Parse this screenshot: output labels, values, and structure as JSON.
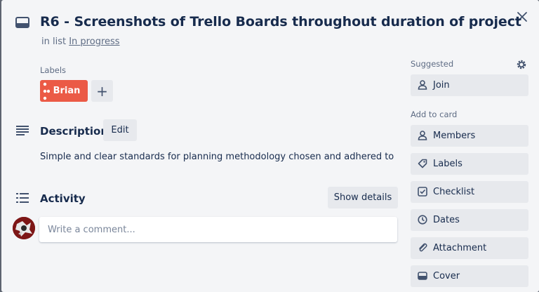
{
  "card": {
    "title": "R6 - Screenshots of Trello Boards throughout duration of project",
    "in_list_prefix": "in list",
    "list_name": "In progress"
  },
  "labels": {
    "heading": "Labels",
    "items": [
      {
        "name": "Brian",
        "color": "#eb5a46"
      }
    ],
    "add_symbol": "+"
  },
  "description": {
    "heading": "Description",
    "edit_label": "Edit",
    "text": "Simple and clear standards for planning methodology chosen and adhered to"
  },
  "activity": {
    "heading": "Activity",
    "show_details_label": "Show details",
    "comment_placeholder": "Write a comment..."
  },
  "sidebar": {
    "suggested_heading": "Suggested",
    "join_label": "Join",
    "add_to_card_heading": "Add to card",
    "buttons": [
      {
        "label": "Members",
        "icon": "person-icon"
      },
      {
        "label": "Labels",
        "icon": "tag-icon"
      },
      {
        "label": "Checklist",
        "icon": "checkbox-icon"
      },
      {
        "label": "Dates",
        "icon": "clock-icon"
      },
      {
        "label": "Attachment",
        "icon": "paperclip-icon"
      },
      {
        "label": "Cover",
        "icon": "cover-icon"
      }
    ]
  },
  "colors": {
    "label_red": "#eb5a46",
    "text_primary": "#172b4d",
    "text_secondary": "#5e6c84",
    "button_bg": "#e7e9ed",
    "modal_bg": "#f4f5f7"
  }
}
